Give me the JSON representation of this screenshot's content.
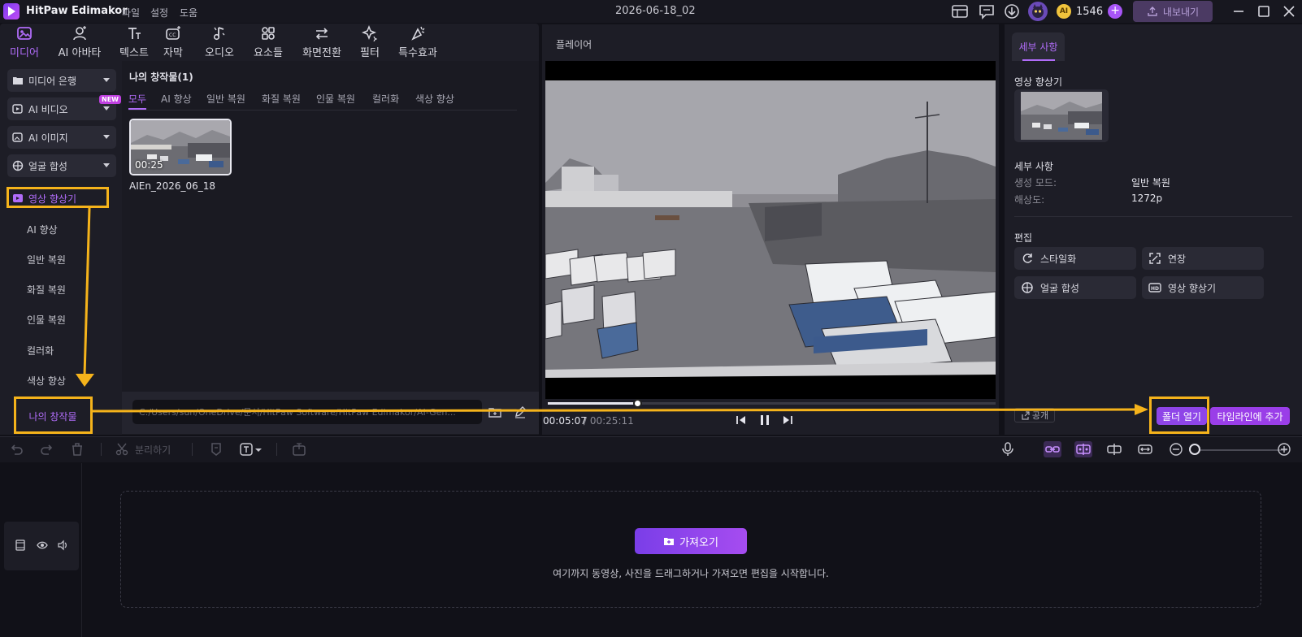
{
  "titlebar": {
    "app_name": "HitPaw Edimakor",
    "menus": [
      "파일",
      "설정",
      "도움"
    ],
    "project_title": "2026-06-18_02",
    "credit_coin": "AI",
    "credits": "1546",
    "export_label": "내보내기"
  },
  "tool_tabs": [
    {
      "label": "미디어",
      "icon": "media-icon",
      "active": true
    },
    {
      "label": "AI 아바타",
      "icon": "avatar-icon"
    },
    {
      "label": "텍스트",
      "icon": "text-icon"
    },
    {
      "label": "자막",
      "icon": "caption-icon"
    },
    {
      "label": "오디오",
      "icon": "music-icon"
    },
    {
      "label": "요소들",
      "icon": "elements-icon"
    },
    {
      "label": "화면전환",
      "icon": "transition-icon"
    },
    {
      "label": "필터",
      "icon": "filter-icon"
    },
    {
      "label": "특수효과",
      "icon": "effects-icon"
    }
  ],
  "sidebar": {
    "categories": [
      "미디어 은행",
      "AI 비디오",
      "AI  이미지",
      "얼굴 합성"
    ],
    "new_badge": "NEW",
    "enhancer": "영상 향상기",
    "sub_items": [
      "AI 향상",
      "일반 복원",
      "화질 복원",
      "인물 복원",
      "컬러화",
      "색상 향상",
      "나의 창작물"
    ]
  },
  "media": {
    "title": "나의 창작물(1)",
    "filters": [
      "모두",
      "AI 향상",
      "일반 복원",
      "화질 복원",
      "인물 복원",
      "컬러화",
      "색상 향상"
    ],
    "thumb_duration": "00:25",
    "thumb_name": "AIEn_2026_06_18",
    "path": "C:/Users/sun/OneDrive/문서/HitPaw Software/HitPaw Edimakor/AI-Gen..."
  },
  "player": {
    "label": "플레이어",
    "time_current": "00:05:07",
    "time_total": "/ 00:25:11",
    "progress": 0.2
  },
  "details": {
    "tab": "세부 사항",
    "enhancer_title": "영상 향상기",
    "details_title": "세부 사항",
    "mode_key": "생성 모드:",
    "mode_value": "일반 복원",
    "res_key": "해상도:",
    "res_value": "1272p",
    "edit_title": "편집",
    "edit_buttons": [
      "스타일화",
      "연장",
      "얼굴 합성",
      "영상 향상기"
    ],
    "share": "공개",
    "open_folder": "폴더 열기",
    "add_timeline": "타임라인에 추가"
  },
  "timeline": {
    "split_label": "분리하기",
    "import_label": "가져오기",
    "drop_hint": "여기까지 동영상, 사진을 드래그하거나 가져오면 편집을 시작합니다."
  },
  "colors": {
    "accent": "#b06cf8",
    "highlight": "#f5b31b",
    "background": "#111118"
  }
}
